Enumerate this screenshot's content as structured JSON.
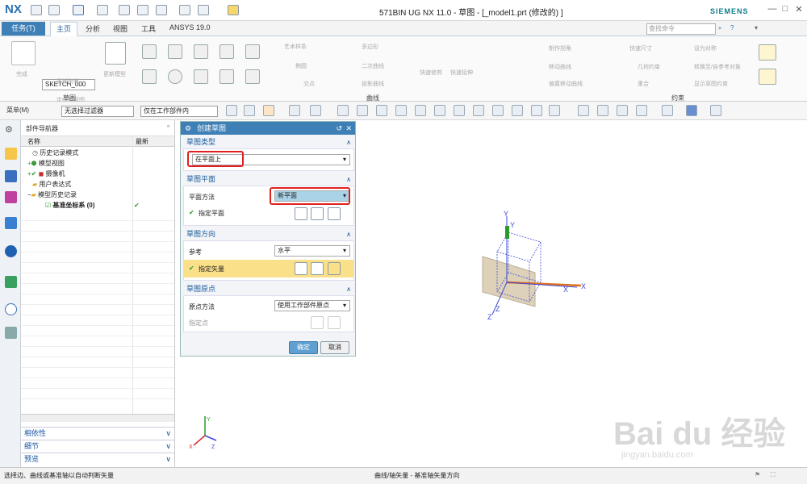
{
  "app": {
    "logo": "NX",
    "title": "571BIN UG NX 11.0 - 草图 - [_model1.prt  (修改的) ]",
    "brand": "SIEMENS"
  },
  "tabs": {
    "task": "任务(T)",
    "items": [
      "主页",
      "分析",
      "视图",
      "工具",
      "ANSYS 19.0"
    ]
  },
  "search": {
    "placeholder": "查找命令"
  },
  "ribbon": {
    "sketch_name": "SKETCH_000",
    "finish": "完成",
    "sketch_group": "草图",
    "curve_group": "曲线",
    "constraint_group": "约束",
    "orient": "定向到草图",
    "reattach": "重新附着",
    "update_model": "更新模型",
    "r_items": [
      "艺术样条",
      "多边形",
      "椭圆",
      "二次曲线",
      "交点",
      "投影曲线"
    ],
    "r_items2": [
      "快速修剪",
      "快速延伸",
      "制作拐角",
      "移动曲线",
      "偏置移动曲线"
    ],
    "r_items3": [
      "快速尺寸",
      "设为对称",
      "几何约束",
      "转换至/自参考对象",
      "显示草图约束",
      "重合"
    ]
  },
  "toolbar": {
    "menu": "菜单(M)",
    "filter": "无选择过滤器",
    "scope": "仅在工作部件内"
  },
  "navigator": {
    "title": "部件导航器",
    "col_name": "名称",
    "col_latest": "最新",
    "rows": [
      "历史记录模式",
      "模型视图",
      "摄像机",
      "用户表达式",
      "模型历史记录",
      "基准坐标系 (0)"
    ],
    "sections": [
      "相依性",
      "细节",
      "预览"
    ]
  },
  "dialog": {
    "title": "创建草图",
    "sec_type": "草图类型",
    "type_value": "在平面上",
    "sec_plane": "草图平面",
    "plane_method_label": "平面方法",
    "plane_method_value": "新平面",
    "specify_plane": "指定平面",
    "sec_dir": "草图方向",
    "ref_label": "参考",
    "ref_value": "水平",
    "specify_vector": "指定矢量",
    "sec_origin": "草图原点",
    "origin_method_label": "原点方法",
    "origin_method_value": "使用工作部件原点",
    "specify_point": "指定点",
    "ok": "确定",
    "cancel": "取消"
  },
  "viewport": {
    "axis_x": "X",
    "axis_y": "Y",
    "axis_z": "Z"
  },
  "status": {
    "left": "选择边、曲线或基准轴以自动判断矢量",
    "mid": "曲线/轴矢量 - 基准轴矢量方向"
  },
  "watermark": {
    "main": "Bai du 经验",
    "url": "jingyan.baidu.com"
  }
}
